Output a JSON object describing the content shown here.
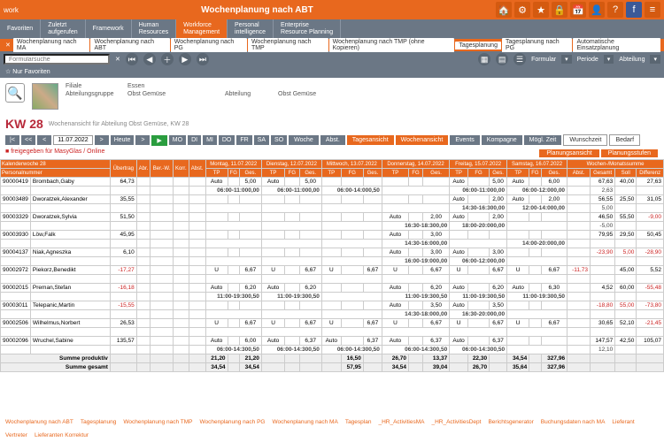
{
  "app": {
    "title": "Wochenplanung nach ABT",
    "brand": "work"
  },
  "menu": [
    "Favoriten",
    "Zuletzt aufgerufen",
    "Framework",
    "Human Resources",
    "Workforce Management",
    "Personal intelligence",
    "Enterprise Resource Planning"
  ],
  "menuActive": 4,
  "tabs": [
    "Wochenplanung nach MA",
    "Wochenplanung nach ABT",
    "Wochenplanung nach PG",
    "Wochenplanung nach TMP",
    "Wochenplanung nach TMP (ohne Kopieren)",
    "Tagesplanung",
    "Tagesplanung nach PG",
    "Automatische Einsatzplanung"
  ],
  "toolbar": {
    "searchPlaceholder": "Formularsuche",
    "favorites": "Nur Favoriten",
    "formular": "Formular",
    "periode": "Periode",
    "abteilung": "Abteilung"
  },
  "filter": {
    "filialeLabel": "Filiale",
    "filialeVal": "Essen",
    "abtgrpLabel": "Abteilungsgruppe",
    "abtgrpVal": "Obst Gemüse",
    "abtLabel": "Abteilung",
    "abtVal": "Obst Gemüse"
  },
  "kw": {
    "label": "KW 28",
    "sub": "Wochenansicht für Abteilung Obst Gemüse, KW 28"
  },
  "nav": {
    "date": "11.07.2022",
    "heute": "Heute",
    "days": [
      "MO",
      "DI",
      "MI",
      "DO",
      "FR",
      "SA",
      "SO"
    ],
    "buttons": [
      "Woche",
      "Abst.",
      "Tagesansicht",
      "Wochenansicht",
      "Events",
      "Kompagne",
      "Mögl. Zeit"
    ],
    "whitebtns": [
      "Wunschzeit",
      "Bedarf"
    ]
  },
  "legend": {
    "red": "freigegeben für MasyGlas / Online",
    "tabs": [
      "Planungsansicht",
      "Planungsstufen"
    ]
  },
  "headers": {
    "kw": "Kalenderwoche 28",
    "pn": "Personalnummer",
    "ub": "Übertrag",
    "abr": "Abr.",
    "bw": "Ber.-W.",
    "korr": "Korr.",
    "abst": "Abst.",
    "days": [
      {
        "d": "Montag, 11.07.2022"
      },
      {
        "d": "Dienstag, 12.07.2022"
      },
      {
        "d": "Mittwoch, 13.07.2022"
      },
      {
        "d": "Donnerstag, 14.07.2022"
      },
      {
        "d": "Freitag, 15.07.2022"
      },
      {
        "d": "Samstag, 16.07.2022"
      }
    ],
    "cols": [
      "TP",
      "FG",
      "Ges."
    ],
    "sum": "Wochen-/Monatssumme",
    "sumcols": [
      "Abst.",
      "Gesamt",
      "Soll",
      "Differenz"
    ]
  },
  "rows": [
    {
      "id": "90000419",
      "name": "Brombach,Gaby",
      "ub": "64,73",
      "d": [
        [
          "Auto",
          "",
          "5,00"
        ],
        [
          "Auto",
          "",
          "5,00"
        ],
        [
          "",
          "",
          ""
        ],
        [
          "",
          "",
          ""
        ],
        [
          "Auto",
          "",
          "5,00"
        ],
        [
          "Auto",
          "",
          "6,00"
        ]
      ],
      "s": [
        "",
        "67,63",
        "40,00",
        "27,63"
      ],
      "t": [
        "06:00-11:000,00",
        "06:00-11:000,00",
        "06:00-14:000,50",
        "",
        "06:00-11:000,00",
        "06:00-12:000,00"
      ],
      "tneg": "2,63"
    },
    {
      "id": "90003489",
      "name": "Dworatzek,Alexander",
      "ub": "35,55",
      "d": [
        [
          "",
          "",
          ""
        ],
        [
          "",
          "",
          ""
        ],
        [
          "",
          "",
          ""
        ],
        [
          "",
          "",
          ""
        ],
        [
          "Auto",
          "",
          "2,00"
        ],
        [
          "Auto",
          "",
          "2,00"
        ]
      ],
      "s": [
        "",
        "56,55",
        "25,50",
        "31,05"
      ],
      "t": [
        "",
        "",
        "",
        "",
        "14:30-16:300,00",
        "12:00-14:000,00"
      ],
      "tneg": "5,00"
    },
    {
      "id": "90003329",
      "name": "Dworatzek,Sylvia",
      "ub": "51,50",
      "d": [
        [
          "",
          "",
          ""
        ],
        [
          "",
          "",
          ""
        ],
        [
          "",
          "",
          ""
        ],
        [
          "Auto",
          "",
          "2,00"
        ],
        [
          "Auto",
          "",
          "2,00"
        ],
        [
          "",
          "",
          ""
        ]
      ],
      "s": [
        "",
        "46,50",
        "55,50",
        "-9,00"
      ],
      "t": [
        "",
        "",
        "",
        "16:30-18:300,00",
        "18:00-20:000,00",
        ""
      ],
      "tneg": "-5,00"
    },
    {
      "id": "90003930",
      "name": "Löw,Falk",
      "ub": "45,95",
      "d": [
        [
          "",
          "",
          ""
        ],
        [
          "",
          "",
          ""
        ],
        [
          "",
          "",
          ""
        ],
        [
          "Auto",
          "",
          "3,00"
        ],
        [
          "",
          "",
          ""
        ],
        [
          "",
          "",
          ""
        ]
      ],
      "s": [
        "",
        "79,95",
        "29,50",
        "50,45"
      ],
      "t": [
        "",
        "",
        "",
        "14:30-16:000,00",
        "",
        "14:00-20:000,00"
      ],
      "tneg": ""
    },
    {
      "id": "90004137",
      "name": "Niak,Agneszka",
      "ub": "6,10",
      "d": [
        [
          "",
          "",
          ""
        ],
        [
          "",
          "",
          ""
        ],
        [
          "",
          "",
          ""
        ],
        [
          "Auto",
          "",
          "3,00"
        ],
        [
          "Auto",
          "",
          "3,00"
        ],
        [
          "",
          "",
          ""
        ]
      ],
      "s": [
        "",
        "-23,90",
        "5,00",
        "-28,90"
      ],
      "t": [
        "",
        "",
        "",
        "16:00-19:000,00",
        "06:00-12:000,00",
        ""
      ],
      "tneg": "",
      "ovneg": true
    },
    {
      "id": "90002972",
      "name": "Piekorz,Benedikt",
      "ub": "-17,27",
      "ubneg": true,
      "d": [
        [
          "U",
          "",
          "6,67"
        ],
        [
          "U",
          "",
          "6,67"
        ],
        [
          "U",
          "",
          "6,67"
        ],
        [
          "U",
          "",
          "6,67"
        ],
        [
          "U",
          "",
          "6,67"
        ],
        [
          "U",
          "",
          "6,67"
        ]
      ],
      "s": [
        "-11,73",
        "",
        "45,00",
        "5,52"
      ],
      "t": [
        "",
        "",
        "",
        "",
        "",
        ""
      ],
      "tneg": ""
    },
    {
      "id": "90002015",
      "name": "Preman,Stefan",
      "ub": "-16,18",
      "ubneg": true,
      "d": [
        [
          "Auto",
          "",
          "6,20"
        ],
        [
          "Auto",
          "",
          "6,20"
        ],
        [
          "",
          "",
          ""
        ],
        [
          "Auto",
          "",
          "6,20"
        ],
        [
          "Auto",
          "",
          "6,20"
        ],
        [
          "Auto",
          "",
          "6,30"
        ]
      ],
      "s": [
        "",
        "4,52",
        "60,00",
        "-55,48"
      ],
      "t": [
        "11:00-19:300,50",
        "11:00-19:300,50",
        "",
        "11:00-19:300,50",
        "11:00-19:300,50",
        "11:00-19:300,50"
      ],
      "tneg": ""
    },
    {
      "id": "90003011",
      "name": "Telepanic,Martin",
      "ub": "-15,55",
      "ubneg": true,
      "d": [
        [
          "",
          "",
          ""
        ],
        [
          "",
          "",
          ""
        ],
        [
          "",
          "",
          ""
        ],
        [
          "Auto",
          "",
          "3,50"
        ],
        [
          "Auto",
          "",
          "3,50"
        ],
        [
          "",
          "",
          ""
        ]
      ],
      "s": [
        "",
        "-18,80",
        "55,00",
        "-73,80"
      ],
      "t": [
        "",
        "",
        "",
        "14:30-18:000,00",
        "16:30-20:000,00",
        ""
      ],
      "tneg": "",
      "ovneg": true
    },
    {
      "id": "90002506",
      "name": "Wilhelmus,Norbert",
      "ub": "26,53",
      "d": [
        [
          "U",
          "",
          "6,67"
        ],
        [
          "U",
          "",
          "6,67"
        ],
        [
          "U",
          "",
          "6,67"
        ],
        [
          "U",
          "",
          "6,67"
        ],
        [
          "U",
          "",
          "6,67"
        ],
        [
          "U",
          "",
          "6,67"
        ]
      ],
      "s": [
        "",
        "30,65",
        "52,10",
        "-21,45"
      ],
      "t": [
        "",
        "",
        "",
        "",
        "",
        ""
      ],
      "tneg": ""
    },
    {
      "id": "90002096",
      "name": "Wruchel,Sabine",
      "ub": "135,57",
      "d": [
        [
          "Auto",
          "",
          "6,00"
        ],
        [
          "Auto",
          "",
          "6,37"
        ],
        [
          "Auto",
          "",
          "6,37"
        ],
        [
          "Auto",
          "",
          "6,37"
        ],
        [
          "Auto",
          "",
          "6,37"
        ],
        [
          "",
          "",
          ""
        ]
      ],
      "s": [
        "",
        "147,57",
        "42,50",
        "105,07"
      ],
      "t": [
        "06:00-14:300,50",
        "06:00-14:300,50",
        "06:00-14:300,50",
        "06:00-14:300,50",
        "06:00-14:300,50",
        ""
      ],
      "tneg": "12,10"
    }
  ],
  "sums": {
    "prod": {
      "lbl": "Summe produktiv",
      "v": [
        "21,20",
        "",
        "21,20",
        "",
        "",
        "",
        "",
        "16,50",
        "",
        "26,70",
        "",
        "13,37",
        "",
        "22,30",
        "",
        "34,54",
        "",
        "327,96",
        "",
        ""
      ]
    },
    "tot": {
      "lbl": "Summe gesamt",
      "v": [
        "34,54",
        "",
        "34,54",
        "",
        "",
        "",
        "",
        "57,95",
        "",
        "34,54",
        "",
        "39,04",
        "",
        "26,70",
        "",
        "35,64",
        "",
        "327,96",
        "",
        ""
      ]
    }
  },
  "footer": [
    "Wochenplanung nach ABT",
    "Tagesplanung",
    "Wochenplanung nach TMP",
    "Wochenplanung nach PG",
    "Wochenplanung nach MA",
    "Tagesplan",
    "_HR_ActivitiesMA",
    "_HR_ActivitiesDept",
    "Berichtsgenerator",
    "Buchungsdaten nach MA",
    "Lieferant",
    "Vertreter",
    "Lieferanten Korrektur"
  ]
}
